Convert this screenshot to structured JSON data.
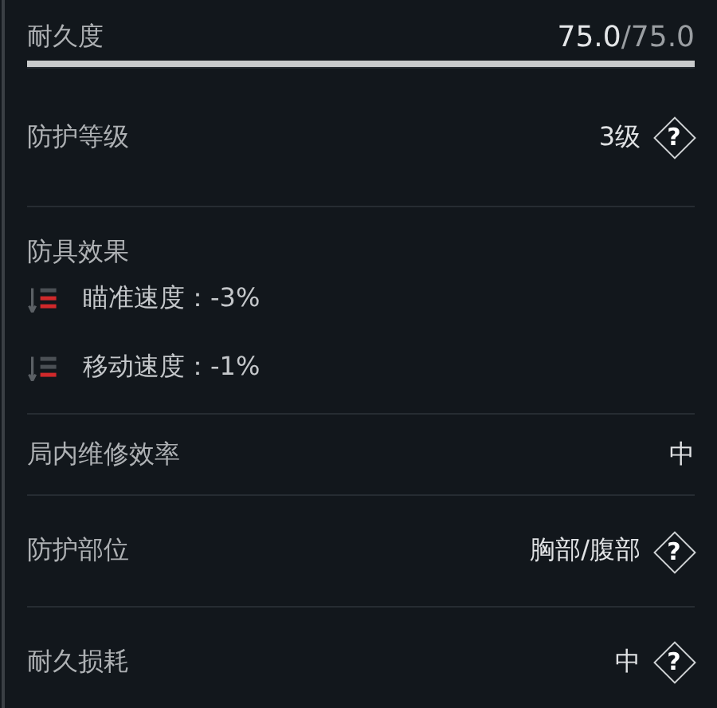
{
  "durability": {
    "label": "耐久度",
    "current": "75.0",
    "max": "/75.0",
    "level": 1
  },
  "sections": [
    {
      "kind": "stat",
      "label": "防护等级",
      "value": "3级",
      "help": "?"
    },
    {
      "kind": "effects",
      "label": "防具效果",
      "effects": [
        {
          "text": "瞄准速度：-3%",
          "strong": true
        },
        {
          "text": "移动速度：-1%",
          "strong": false
        }
      ]
    },
    {
      "kind": "stat",
      "label": "局内维修效率",
      "value": "中"
    },
    {
      "kind": "stat",
      "label": "防护部位",
      "value": "胸部/腹部",
      "help": "?"
    },
    {
      "kind": "stat",
      "label": "耐久损耗",
      "value": "中",
      "help": "?"
    }
  ]
}
